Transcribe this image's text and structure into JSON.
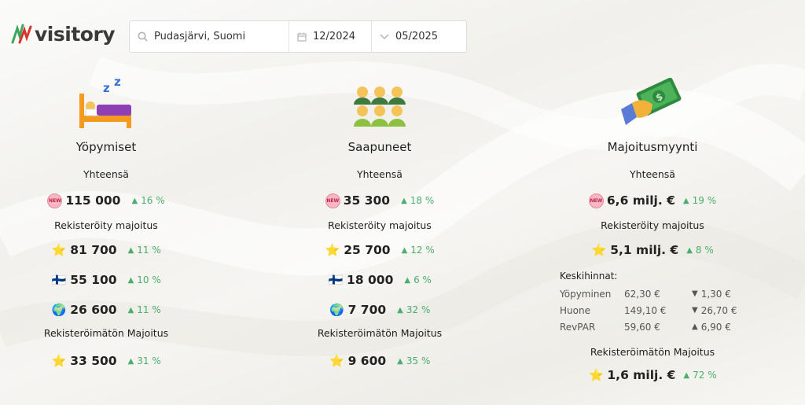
{
  "app": {
    "logo_text": "visitory",
    "accent": "#4cae6e",
    "new_badge": "NEW"
  },
  "search": {
    "location": "Pudasjärvi, Suomi",
    "from": "12/2024",
    "to": "05/2025"
  },
  "columns": [
    {
      "title": "Yöpymiset",
      "total_label": "Yhteensä",
      "total": {
        "value": "115 000",
        "change": "16 %"
      },
      "registered_label": "Rekisteröity majoitus",
      "registered": [
        {
          "icon": "star-icon",
          "value": "81 700",
          "change": "11 %"
        },
        {
          "icon": "finland-flag-icon",
          "value": "55 100",
          "change": "10 %"
        },
        {
          "icon": "globe-icon",
          "value": "26 600",
          "change": "11 %"
        }
      ],
      "unregistered_label": "Rekisteröimätön Majoitus",
      "unregistered": {
        "icon": "star-icon",
        "value": "33 500",
        "change": "31 %"
      }
    },
    {
      "title": "Saapuneet",
      "total_label": "Yhteensä",
      "total": {
        "value": "35 300",
        "change": "18 %"
      },
      "registered_label": "Rekisteröity majoitus",
      "registered": [
        {
          "icon": "star-icon",
          "value": "25 700",
          "change": "12 %"
        },
        {
          "icon": "finland-flag-icon",
          "value": "18 000",
          "change": "6 %"
        },
        {
          "icon": "globe-icon",
          "value": "7 700",
          "change": "32 %"
        }
      ],
      "unregistered_label": "Rekisteröimätön Majoitus",
      "unregistered": {
        "icon": "star-icon",
        "value": "9 600",
        "change": "35 %"
      }
    },
    {
      "title": "Majoitusmyynti",
      "total_label": "Yhteensä",
      "total": {
        "value": "6,6 milj. €",
        "change": "19 %"
      },
      "registered_label": "Rekisteröity majoitus",
      "registered": [
        {
          "icon": "star-icon",
          "value": "5,1 milj. €",
          "change": "8 %"
        }
      ],
      "avg_prices": {
        "title": "Keskihinnat:",
        "rows": [
          {
            "name": "Yöpyminen",
            "value": "62,30 €",
            "direction": "down",
            "change": "1,30 €"
          },
          {
            "name": "Huone",
            "value": "149,10 €",
            "direction": "down",
            "change": "26,70 €"
          },
          {
            "name": "RevPAR",
            "value": "59,60 €",
            "direction": "up",
            "change": "6,90 €"
          }
        ]
      },
      "unregistered_label": "Rekisteröimätön Majoitus",
      "unregistered": {
        "icon": "star-icon",
        "value": "1,6 milj. €",
        "change": "72 %"
      }
    }
  ]
}
